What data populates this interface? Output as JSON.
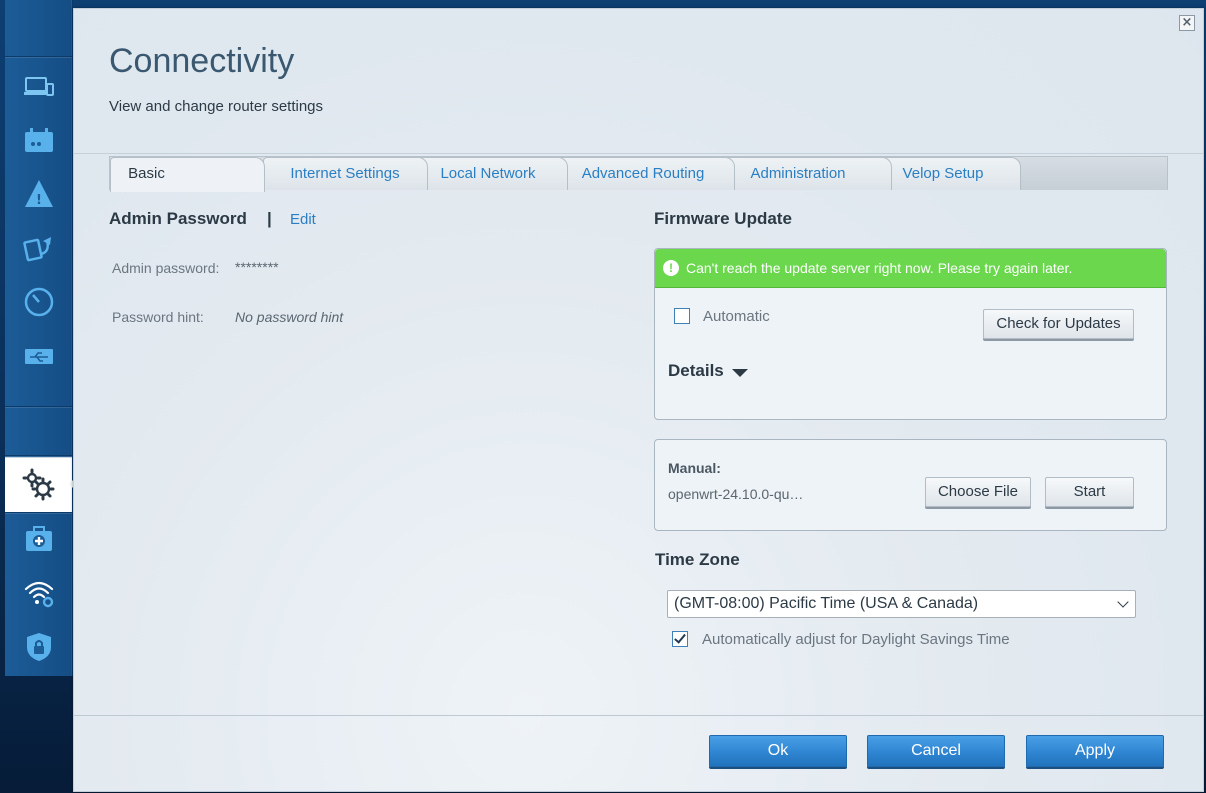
{
  "sidebar": {
    "icons": [
      "devices-icon",
      "router-icon",
      "warning-icon",
      "backup-icon",
      "speed-icon",
      "usb-icon"
    ],
    "active_icon": "settings-gears-icon",
    "lower_icons": [
      "troubleshooting-icon",
      "wifi-settings-icon",
      "security-icon"
    ]
  },
  "header": {
    "title": "Connectivity",
    "subtitle": "View and change router settings",
    "close_icon": "close-icon"
  },
  "tabs": [
    {
      "label": "Basic",
      "active": true
    },
    {
      "label": "Internet Settings",
      "active": false
    },
    {
      "label": "Local Network",
      "active": false
    },
    {
      "label": "Advanced Routing",
      "active": false
    },
    {
      "label": "Administration",
      "active": false
    },
    {
      "label": "Velop Setup",
      "active": false
    }
  ],
  "admin": {
    "heading": "Admin Password",
    "separator": "|",
    "edit_link": "Edit",
    "password_label": "Admin password:",
    "password_value": "********",
    "hint_label": "Password hint:",
    "hint_value": "No password hint"
  },
  "firmware": {
    "heading": "Firmware Update",
    "banner_text": "Can't reach the update server right now. Please try again later.",
    "banner_color": "#6ad74d",
    "automatic_label": "Automatic",
    "automatic_checked": false,
    "check_button": "Check for Updates",
    "details_label": "Details",
    "manual_label": "Manual:",
    "manual_file": "openwrt-24.10.0-qu…",
    "choose_file_button": "Choose File",
    "start_button": "Start"
  },
  "timezone": {
    "heading": "Time Zone",
    "selected": "(GMT-08:00) Pacific Time (USA & Canada)",
    "dst_label": "Automatically adjust for Daylight Savings Time",
    "dst_checked": true
  },
  "footer": {
    "ok": "Ok",
    "cancel": "Cancel",
    "apply": "Apply",
    "accent_color": "#2f85d1"
  }
}
